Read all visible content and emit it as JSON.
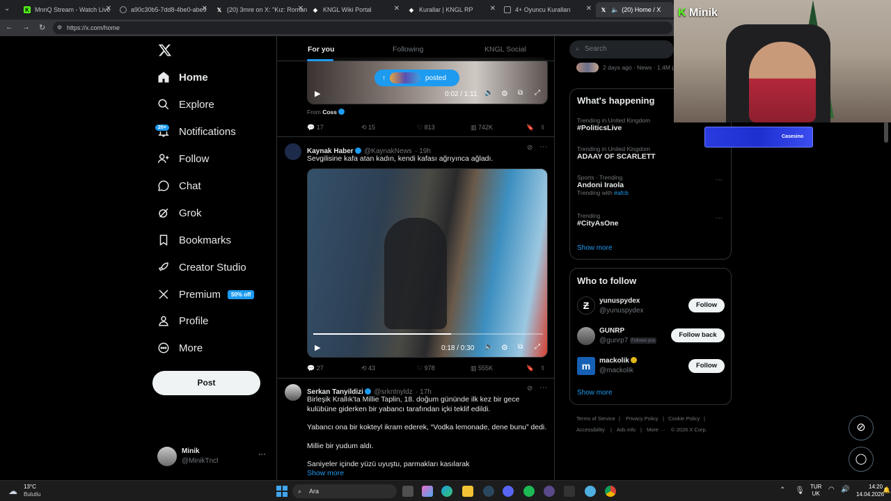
{
  "browser": {
    "tabs": [
      {
        "label": "MnnQ Stream - Watch Live",
        "color": "#53fc18",
        "glyph": "K"
      },
      {
        "label": "a90c30b5-7dd8-4be0-abe9",
        "color": "#5f6368",
        "glyph": ""
      },
      {
        "label": "(20) 3mre on X: \"Kız: Roman",
        "color": "#000000",
        "glyph": "X"
      },
      {
        "label": "KNGL Wiki Portal",
        "color": "#ffffff",
        "glyph": "◆"
      },
      {
        "label": "Kurallar | KNGL RP",
        "color": "#ffffff",
        "glyph": "◆"
      },
      {
        "label": "4+ Oyuncu Kuralları",
        "color": "#5f6368",
        "glyph": ""
      },
      {
        "label": "(20) Home / X",
        "color": "#000000",
        "glyph": "X"
      }
    ],
    "url": "https://x.com/home"
  },
  "sidebar": {
    "items": [
      {
        "label": "Home"
      },
      {
        "label": "Explore"
      },
      {
        "label": "Notifications",
        "badge": "20+"
      },
      {
        "label": "Follow"
      },
      {
        "label": "Chat"
      },
      {
        "label": "Grok"
      },
      {
        "label": "Bookmarks"
      },
      {
        "label": "Creator Studio"
      },
      {
        "label": "Premium",
        "badge": "50% off"
      },
      {
        "label": "Profile"
      },
      {
        "label": "More"
      }
    ],
    "post_button": "Post",
    "account": {
      "name": "Minik",
      "handle": "@MinikTncl",
      "more": "···"
    }
  },
  "timeline": {
    "tabs": [
      "For you",
      "Following",
      "KNGL Social"
    ],
    "posted_pill": "posted",
    "tweet1": {
      "time": "0:02 / 1:11",
      "from_label": "From",
      "from_name": "Coss",
      "replies": "17",
      "reposts": "15",
      "likes": "813",
      "views": "742K"
    },
    "tweet2": {
      "name": "Kaynak Haber",
      "handle": "@KaynakNews",
      "age": "· 19h",
      "text": "Sevgilisine kafa atan kadın, kendi kafası ağrıyınca ağladı.",
      "time": "0:18 / 0:30",
      "progress": 0.6,
      "replies": "27",
      "reposts": "43",
      "likes": "978",
      "views": "555K"
    },
    "tweet3": {
      "name": "Serkan Tanyildizi",
      "handle": "@srkntnyldz",
      "age": "· 17h",
      "p1": "Birleşik Krallık'ta Millie Taplin, 18. doğum gününde ilk kez bir gece kulübüne giderken bir yabancı tarafından içki teklif edildi.",
      "p2": "Yabancı ona bir kokteyl ikram ederek, “Vodka lemonade, dene bunu” dedi.",
      "p3": "Millie bir yudum aldı.",
      "p4": "Saniyeler içinde yüzü uyuştu, parmakları kasılarak",
      "show_more": "Show more"
    }
  },
  "right": {
    "search_placeholder": "Search",
    "news_meta": "2 days ago · News · 1.4M p",
    "happening": {
      "title": "What's happening",
      "trends": [
        {
          "meta": "Trending in United Kingdom",
          "name": "#PoliticsLive",
          "extra": ""
        },
        {
          "meta": "Trending in United Kingdom",
          "name": "ADAAY OF SCARLETT",
          "extra": ""
        },
        {
          "meta": "Sports · Trending",
          "name": "Andoni Iraola",
          "extra_prefix": "Trending with",
          "extra": "#afcb"
        },
        {
          "meta": "Trending",
          "name": "#CityAsOne",
          "extra": ""
        }
      ],
      "show_more": "Show more"
    },
    "who": {
      "title": "Who to follow",
      "accounts": [
        {
          "name": "yunuspydex",
          "handle": "@yunuspydex",
          "button": "Follow",
          "tag": ""
        },
        {
          "name": "GUNRP",
          "handle": "@gunrp7",
          "button": "Follow back",
          "tag": "Follows you"
        },
        {
          "name": "mackolik",
          "handle": "@mackolik",
          "button": "Follow",
          "tag": ""
        }
      ],
      "show_more": "Show more"
    },
    "footer": [
      "Terms of Service",
      "|",
      "Privacy Policy",
      "|",
      "Cookie Policy",
      "|",
      "Accessibility",
      "|",
      "Ads info",
      "|",
      "More ···",
      "© 2026 X Corp."
    ]
  },
  "overlay": {
    "streamer": "Minik",
    "banner": "Casesino"
  },
  "taskbar": {
    "temp": "13°C",
    "weather": "Bulutlu",
    "search": "Ara",
    "lang1": "TUR",
    "lang2": "UK",
    "time": "14:20",
    "date": "14.04.2026"
  }
}
